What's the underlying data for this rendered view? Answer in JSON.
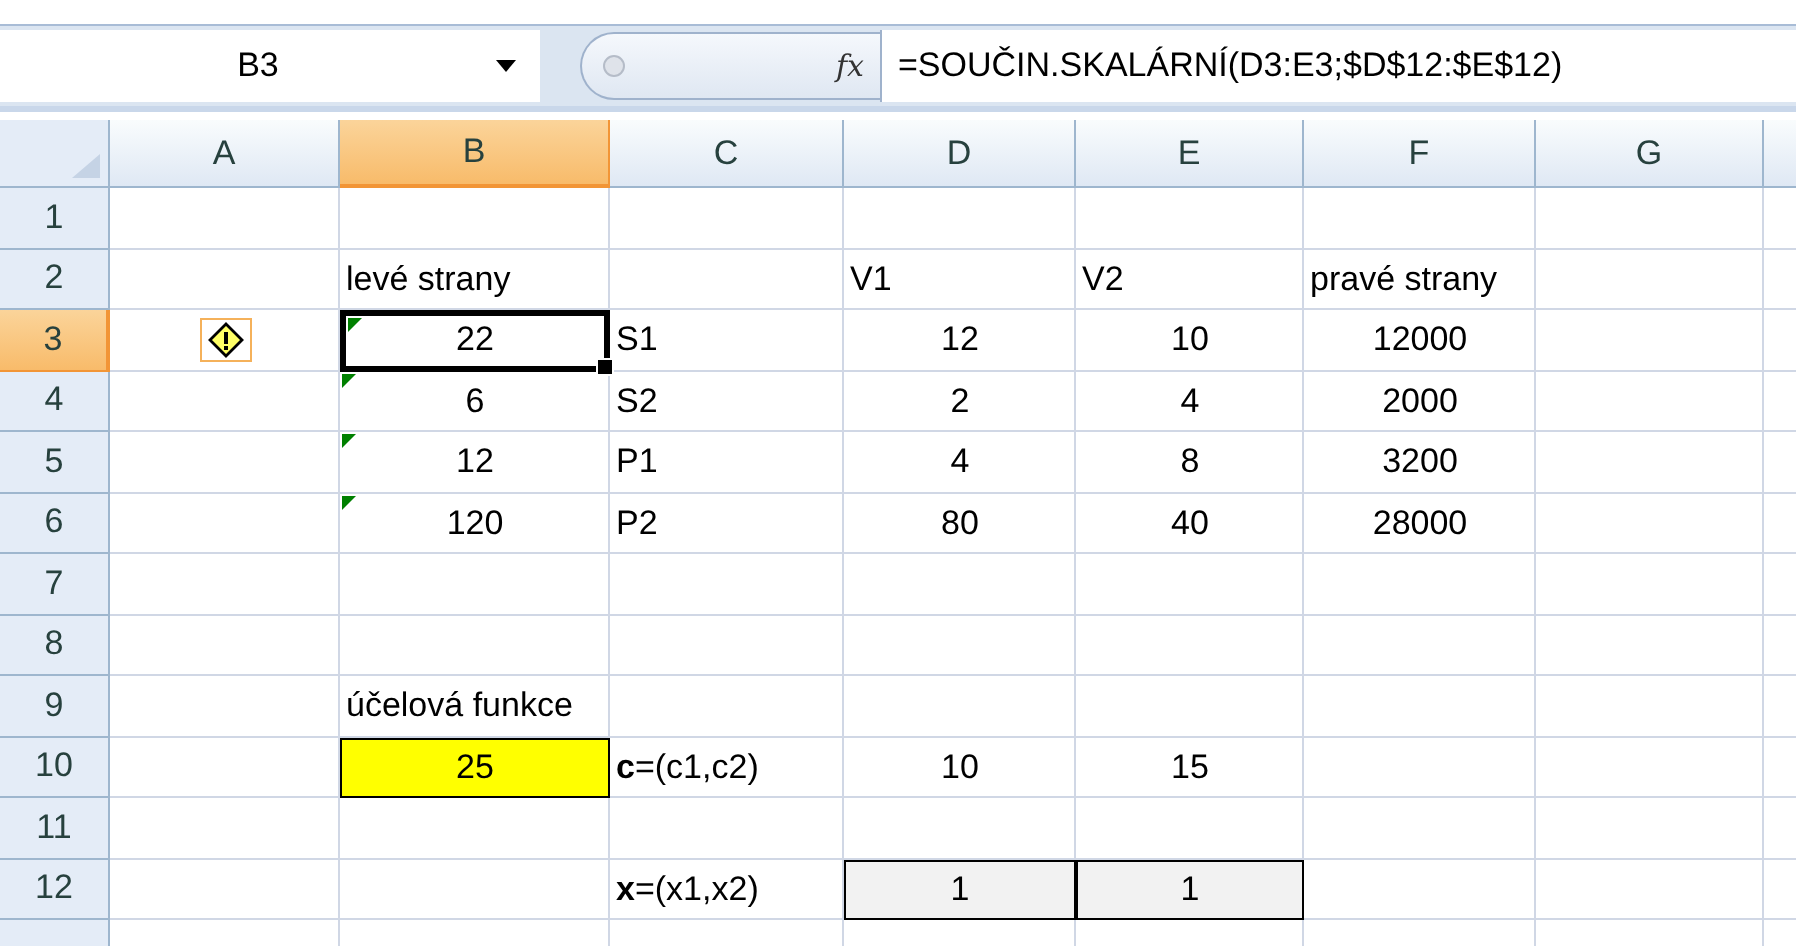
{
  "formula_bar": {
    "name_box": "B3",
    "function_label": "fx",
    "formula": "=SOUČIN.SKALÁRNÍ(D3:E3;$D$12:$E$12)"
  },
  "columns": [
    {
      "label": "A",
      "selected": false
    },
    {
      "label": "B",
      "selected": true
    },
    {
      "label": "C",
      "selected": false
    },
    {
      "label": "D",
      "selected": false
    },
    {
      "label": "E",
      "selected": false
    },
    {
      "label": "F",
      "selected": false
    },
    {
      "label": "G",
      "selected": false
    }
  ],
  "rows": [
    {
      "number": "1",
      "selected": false,
      "cells": [
        null,
        null,
        null,
        null,
        null,
        null,
        null
      ]
    },
    {
      "number": "2",
      "selected": false,
      "cells": [
        null,
        {
          "text": "levé strany",
          "kind": "label"
        },
        null,
        {
          "text": "V1",
          "kind": "label"
        },
        {
          "text": "V2",
          "kind": "label"
        },
        {
          "text": "pravé strany",
          "kind": "label"
        },
        null
      ]
    },
    {
      "number": "3",
      "selected": true,
      "cells": [
        {
          "kind": "warning"
        },
        {
          "text": "22",
          "kind": "number",
          "error_flag": true,
          "selected": true
        },
        {
          "text": "S1",
          "kind": "label"
        },
        {
          "text": "12",
          "kind": "number"
        },
        {
          "text": "10",
          "kind": "number"
        },
        {
          "text": "12000",
          "kind": "number"
        },
        null
      ]
    },
    {
      "number": "4",
      "selected": false,
      "cells": [
        null,
        {
          "text": "6",
          "kind": "number",
          "error_flag": true,
          "selected": false
        },
        {
          "text": "S2",
          "kind": "label"
        },
        {
          "text": "2",
          "kind": "number"
        },
        {
          "text": "4",
          "kind": "number"
        },
        {
          "text": "2000",
          "kind": "number"
        },
        null
      ]
    },
    {
      "number": "5",
      "selected": false,
      "cells": [
        null,
        {
          "text": "12",
          "kind": "number",
          "error_flag": true,
          "selected": false
        },
        {
          "text": "P1",
          "kind": "label"
        },
        {
          "text": "4",
          "kind": "number"
        },
        {
          "text": "8",
          "kind": "number"
        },
        {
          "text": "3200",
          "kind": "number"
        },
        null
      ]
    },
    {
      "number": "6",
      "selected": false,
      "cells": [
        null,
        {
          "text": "120",
          "kind": "number",
          "error_flag": true,
          "selected": false
        },
        {
          "text": "P2",
          "kind": "label"
        },
        {
          "text": "80",
          "kind": "number"
        },
        {
          "text": "40",
          "kind": "number"
        },
        {
          "text": "28000",
          "kind": "number"
        },
        null
      ]
    },
    {
      "number": "7",
      "selected": false,
      "cells": [
        null,
        null,
        null,
        null,
        null,
        null,
        null
      ]
    },
    {
      "number": "8",
      "selected": false,
      "cells": [
        null,
        null,
        null,
        null,
        null,
        null,
        null
      ]
    },
    {
      "number": "9",
      "selected": false,
      "cells": [
        null,
        {
          "text": "účelová funkce",
          "kind": "label"
        },
        null,
        null,
        null,
        null,
        null
      ]
    },
    {
      "number": "10",
      "selected": false,
      "cells": [
        null,
        {
          "text": "25",
          "kind": "highlight"
        },
        {
          "text": "**c**=(c1,c2)",
          "kind": "label"
        },
        {
          "text": "10",
          "kind": "number"
        },
        {
          "text": "15",
          "kind": "number"
        },
        null,
        null
      ]
    },
    {
      "number": "11",
      "selected": false,
      "cells": [
        null,
        null,
        null,
        null,
        null,
        null,
        null
      ]
    },
    {
      "number": "12",
      "selected": false,
      "cells": [
        null,
        null,
        {
          "text": "**x**=(x1,x2)",
          "kind": "label"
        },
        {
          "text": "1",
          "kind": "input"
        },
        {
          "text": "1",
          "kind": "input"
        },
        null,
        null
      ]
    }
  ]
}
